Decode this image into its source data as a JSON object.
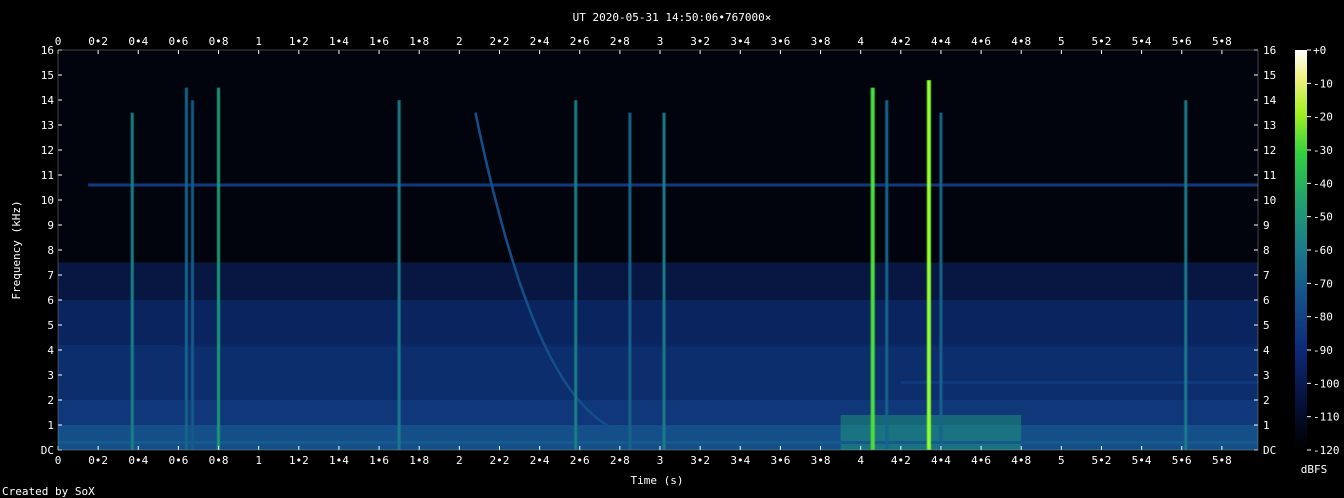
{
  "chart_data": {
    "type": "heatmap",
    "title": "UT 2020-05-31 14:50:06•767000×",
    "xlabel": "Time (s)",
    "ylabel": "Frequency (kHz)",
    "colorbar_label": "dBFS",
    "footer": "Created by SoX",
    "x_ticks": [
      "0",
      "0•2",
      "0•4",
      "0•6",
      "0•8",
      "1",
      "1•2",
      "1•4",
      "1•6",
      "1•8",
      "2",
      "2•2",
      "2•4",
      "2•6",
      "2•8",
      "3",
      "3•2",
      "3•4",
      "3•6",
      "3•8",
      "4",
      "4•2",
      "4•4",
      "4•6",
      "4•8",
      "5",
      "5•2",
      "5•4",
      "5•6",
      "5•8"
    ],
    "y_ticks": [
      "DC",
      "1",
      "2",
      "3",
      "4",
      "5",
      "6",
      "7",
      "8",
      "9",
      "10",
      "11",
      "12",
      "13",
      "14",
      "15",
      "16"
    ],
    "colorbar_ticks": [
      "+0",
      "-10",
      "-20",
      "-30",
      "-40",
      "-50",
      "-60",
      "-70",
      "-80",
      "-90",
      "-100",
      "-110",
      "-120"
    ],
    "xlim": [
      0,
      5.98
    ],
    "ylim": [
      0,
      16
    ],
    "zlim": [
      -120,
      0
    ],
    "colors": {
      "background": "#000000",
      "floor": "#040a22",
      "noise": "#0a2460",
      "mid": "#1e6e96",
      "high": "#38c860",
      "peak": "#90ff30",
      "grid_text": "#ffffff"
    },
    "background_noise_dbfs": [
      {
        "f_max_khz": 1,
        "level": -92
      },
      {
        "f_max_khz": 2,
        "level": -98
      },
      {
        "f_max_khz": 4.2,
        "level": -101
      },
      {
        "f_max_khz": 6,
        "level": -104
      },
      {
        "f_max_khz": 7.5,
        "level": -108
      },
      {
        "f_max_khz": 16,
        "level": -117
      }
    ],
    "tone_lines": [
      {
        "freq_khz": 10.6,
        "level_dbfs": -97,
        "t_start": 0.15,
        "t_end": 5.98
      },
      {
        "freq_khz": 4.2,
        "level_dbfs": -103,
        "t_start": 0.6,
        "t_end": 5.98
      },
      {
        "freq_khz": 2.7,
        "level_dbfs": -97,
        "t_start": 4.2,
        "t_end": 5.98
      },
      {
        "freq_khz": 0.3,
        "level_dbfs": -90,
        "t_start": 0,
        "t_end": 5.98
      }
    ],
    "vertical_events": [
      {
        "t": 0.37,
        "f_top": 13.5,
        "level_dbfs": -82
      },
      {
        "t": 0.64,
        "f_top": 14.5,
        "level_dbfs": -88
      },
      {
        "t": 0.67,
        "f_top": 14.0,
        "level_dbfs": -90
      },
      {
        "t": 0.8,
        "f_top": 14.5,
        "level_dbfs": -72
      },
      {
        "t": 1.7,
        "f_top": 14.0,
        "level_dbfs": -84
      },
      {
        "t": 2.58,
        "f_top": 14.0,
        "level_dbfs": -82
      },
      {
        "t": 2.85,
        "f_top": 13.5,
        "level_dbfs": -88
      },
      {
        "t": 3.02,
        "f_top": 13.5,
        "level_dbfs": -84
      },
      {
        "t": 4.06,
        "f_top": 14.5,
        "level_dbfs": -55
      },
      {
        "t": 4.13,
        "f_top": 14.0,
        "level_dbfs": -88
      },
      {
        "t": 4.34,
        "f_top": 14.8,
        "level_dbfs": -48
      },
      {
        "t": 4.4,
        "f_top": 13.5,
        "level_dbfs": -88
      },
      {
        "t": 5.62,
        "f_top": 14.0,
        "level_dbfs": -84
      }
    ],
    "chirp": {
      "f_start_khz": 13.5,
      "f_end_khz": 0.4,
      "t_start": 2.08,
      "t_end": 3.1,
      "level_dbfs": -92
    },
    "low_freq_hump": {
      "t_start": 3.9,
      "t_end": 4.8,
      "f_max_khz": 1.4,
      "level_dbfs": -75
    }
  }
}
